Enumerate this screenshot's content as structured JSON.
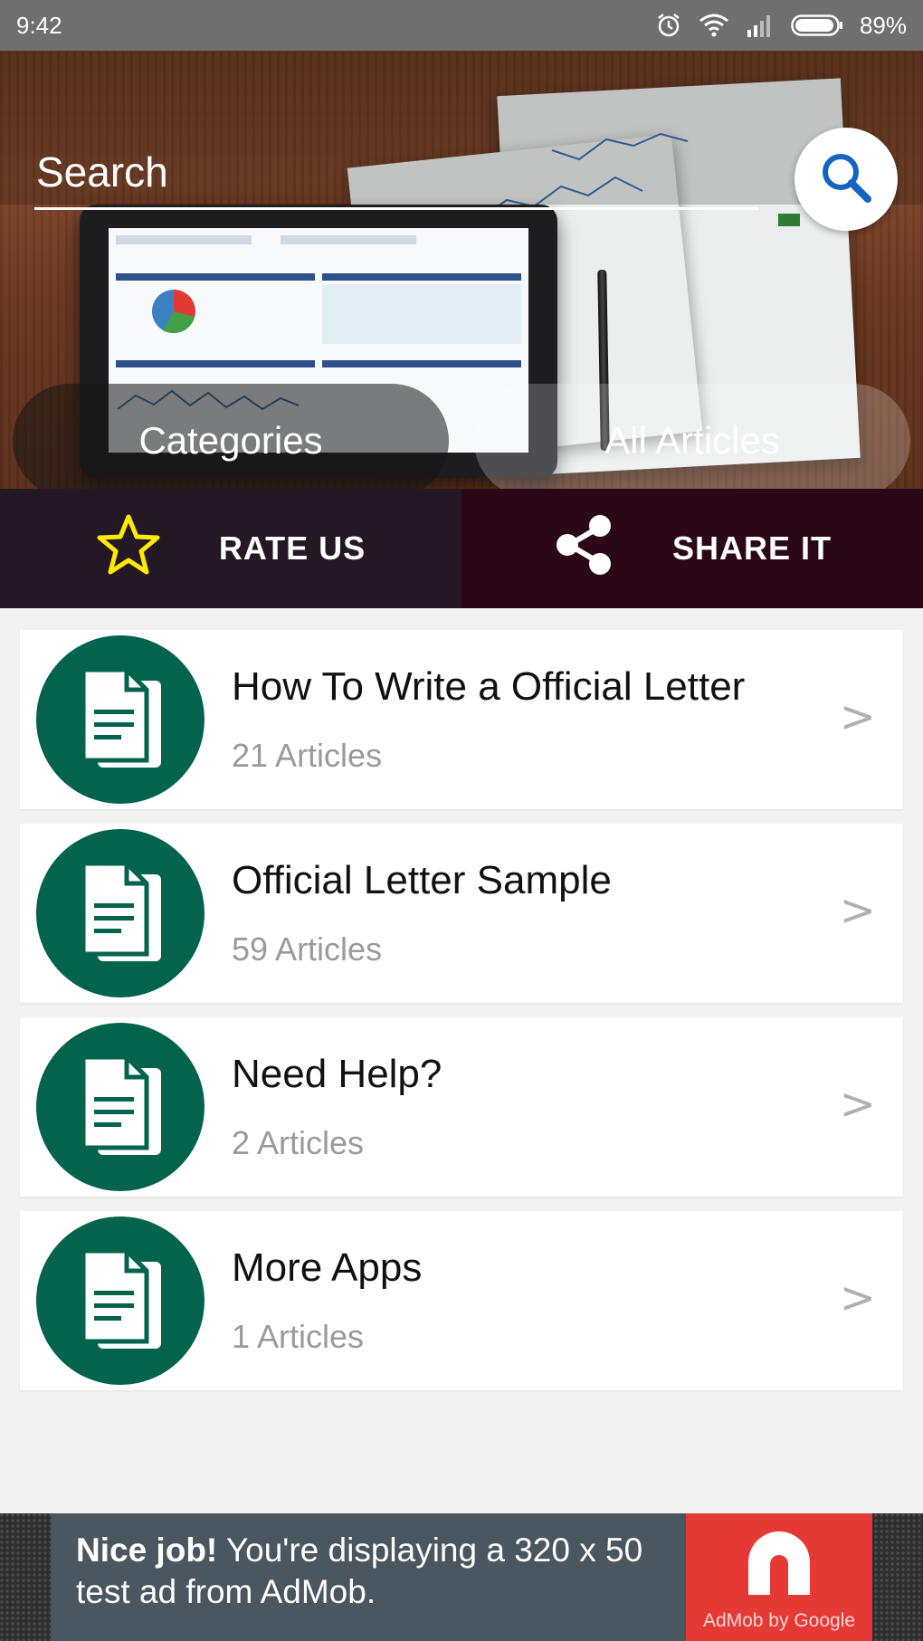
{
  "status_bar": {
    "time": "9:42",
    "battery": "89%",
    "icons": [
      "alarm-icon",
      "wifi-icon",
      "signal-icon",
      "battery-icon"
    ]
  },
  "search": {
    "placeholder": "Search",
    "icon": "search-icon"
  },
  "hero_tabs": {
    "categories": "Categories",
    "all_articles": "All Articles"
  },
  "actions": {
    "rate": {
      "label": "RATE US",
      "icon": "star-icon"
    },
    "share": {
      "label": "SHARE IT",
      "icon": "share-icon"
    }
  },
  "categories": [
    {
      "title": "How To Write a Official Letter",
      "count": "21 Articles",
      "icon": "document-icon"
    },
    {
      "title": "Official Letter Sample",
      "count": "59 Articles",
      "icon": "document-icon"
    },
    {
      "title": "Need Help?",
      "count": "2 Articles",
      "icon": "document-icon"
    },
    {
      "title": "More Apps",
      "count": "1 Articles",
      "icon": "document-icon"
    }
  ],
  "chevron": ">",
  "ad": {
    "bold": "Nice job!",
    "text_line1": " You're displaying a 320 x 50",
    "text_line2": "test ad from AdMob.",
    "logo_label": "AdMob by Google"
  },
  "colors": {
    "status_bar": "#6f6f6f",
    "rate_bg": "#231823",
    "share_bg": "#2b0818",
    "icon_circle": "#03634d",
    "star": "#ffea00",
    "search_icon": "#1565c0",
    "ad_bg": "#4a5660",
    "ad_logo_bg": "#e53935"
  }
}
